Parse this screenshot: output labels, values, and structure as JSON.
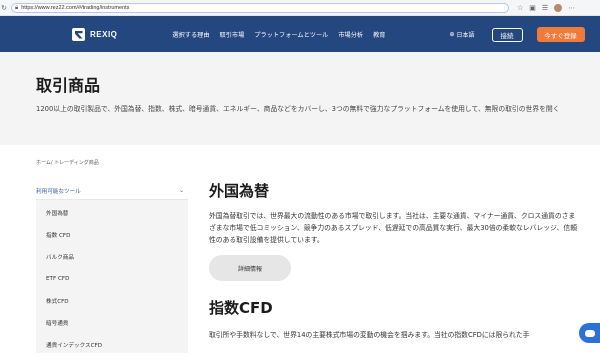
{
  "browser": {
    "url": "https://www.rez22.com/#/trading/instruments"
  },
  "header": {
    "brand": "REXIQ",
    "menu": [
      "選択する理由",
      "取引市場",
      "プラットフォームとツール",
      "市場分析",
      "教育"
    ],
    "language": "日本語",
    "login": "接続",
    "signup": "今すぐ登録"
  },
  "hero": {
    "title": "取引商品",
    "description": "1200以上の取引製品で、外国為替、指数、株式、暗号通貨、エネルギー、商品などをカバーし、3つの無料で強力なプラットフォームを使用して、無限の取引の世界を開く"
  },
  "breadcrumb": "ホーム/ トレーディング商品",
  "sidebar": {
    "heading": "利用可能なツール",
    "items": [
      "外国為替",
      "指数 CFD",
      "バルク商品",
      "ETF CFD",
      "株式CFD",
      "暗号通貨",
      "通貨インデックスCFD"
    ]
  },
  "sections": [
    {
      "title": "外国為替",
      "description": "外国為替取引では、世界最大の流動性のある市場で取引します。当社は、主要な通貨、マイナー通貨、クロス通貨のさまざまな市場で低コミッション、競争力のあるスプレッド、低遅延での高品質な実行、最大30倍の柔軟なレバレッジ、信頼性のある取引設備を提供しています。",
      "button": "詳細情報"
    },
    {
      "title": "指数CFD",
      "description": "取引所や手数料なしで、世界14の主要株式市場の変動の機会を掴みます。当社の指数CFDには限られた手"
    }
  ],
  "colors": {
    "header_bg": "#24477f",
    "signup_bg": "#f07a3a",
    "accent": "#2a5aa8"
  }
}
